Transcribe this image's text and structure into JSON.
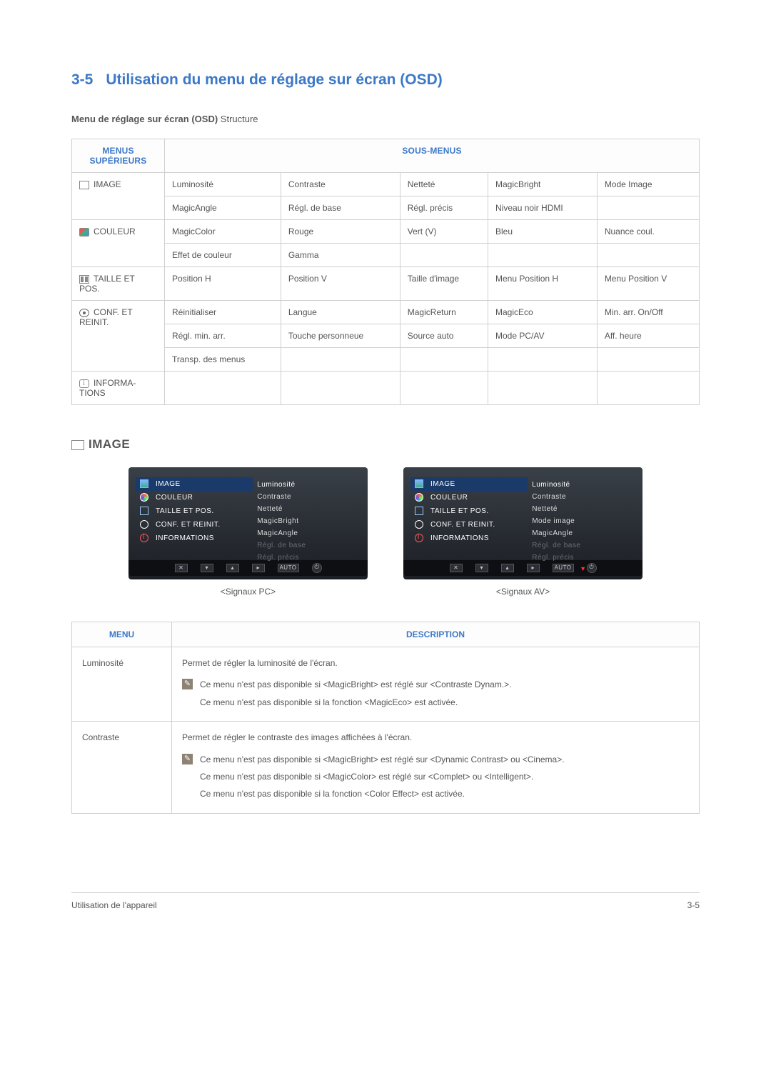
{
  "section_number": "3-5",
  "section_title": "Utilisation du menu de réglage sur écran (OSD)",
  "structure_label_bold": "Menu de réglage sur écran (OSD)",
  "structure_label_rest": " Structure",
  "table_headers": {
    "top": "MENUS SUPÉRIEURS",
    "sub": "SOUS-MENUS"
  },
  "top_menus": {
    "image": "IMAGE",
    "couleur": "COULEUR",
    "taille": "TAILLE ET POS.",
    "conf": "CONF. ET REINIT.",
    "info": "INFORMA­TIONS"
  },
  "rows": {
    "image": [
      [
        "Luminosité",
        "Contraste",
        "Netteté",
        "MagicBright",
        "Mode Image"
      ],
      [
        "MagicAngle",
        "Régl. de base",
        "Régl. précis",
        "Niveau noir HDMI",
        ""
      ]
    ],
    "couleur": [
      [
        "MagicColor",
        "Rouge",
        "Vert (V)",
        "Bleu",
        "Nuance coul."
      ],
      [
        "Effet de couleur",
        "Gamma",
        "",
        "",
        ""
      ]
    ],
    "taille": [
      [
        "Position H",
        "Position V",
        "Taille d'image",
        "Menu Position H",
        "Menu Position V"
      ]
    ],
    "conf": [
      [
        "Réinitialiser",
        "Langue",
        "MagicReturn",
        "MagicEco",
        "Min. arr. On/Off"
      ],
      [
        "Régl. min. arr.",
        "Touche person­neue",
        "Source auto",
        "Mode PC/AV",
        "Aff. heure"
      ],
      [
        "Transp. des menus",
        "",
        "",
        "",
        ""
      ]
    ],
    "info": [
      [
        "",
        "",
        "",
        "",
        ""
      ]
    ]
  },
  "image_heading": "IMAGE",
  "osd": {
    "left_menu": {
      "image": "IMAGE",
      "couleur": "COULEUR",
      "taille": "TAILLE ET POS.",
      "conf": "CONF. ET REINIT.",
      "info": "INFORMATIONS"
    },
    "pc": {
      "items": [
        "Luminosité",
        "Contraste",
        "Netteté",
        "MagicBright",
        "MagicAngle",
        "Régl. de base",
        "Régl. précis"
      ],
      "dim_from": 5,
      "caption": "<Signaux PC>"
    },
    "av": {
      "items": [
        "Luminosité",
        "Contraste",
        "Netteté",
        "Mode image",
        "MagicAngle",
        "Régl. de base",
        "Régl. précis"
      ],
      "dim_from": 5,
      "arrow": true,
      "caption": "<Signaux AV>"
    },
    "footer_buttons": [
      "✕",
      "▾",
      "▴",
      "▸",
      "AUTO",
      "⏻"
    ]
  },
  "desc_headers": {
    "menu": "MENU",
    "desc": "DESCRIPTION"
  },
  "desc_rows": {
    "luminosite": {
      "label": "Luminosité",
      "text": "Permet de régler la luminosité de l'écran.",
      "notes": [
        "Ce menu n'est pas disponible si <MagicBright> est réglé sur <Contraste Dynam.>.",
        "Ce menu n'est pas disponible si la fonction <MagicEco> est activée."
      ]
    },
    "contraste": {
      "label": "Contraste",
      "text": "Permet de régler le contraste des images affichées à l'écran.",
      "notes": [
        "Ce menu n'est pas disponible si <MagicBright> est réglé sur <Dynamic Contrast> ou <Cinema>.",
        "Ce menu n'est pas disponible si <MagicColor> est réglé sur <Complet> ou <Intelligent>.",
        "Ce menu n'est pas disponible si la fonction <Color Effect> est activée."
      ]
    }
  },
  "footer": {
    "left": "Utilisation de l'appareil",
    "right": "3-5"
  }
}
